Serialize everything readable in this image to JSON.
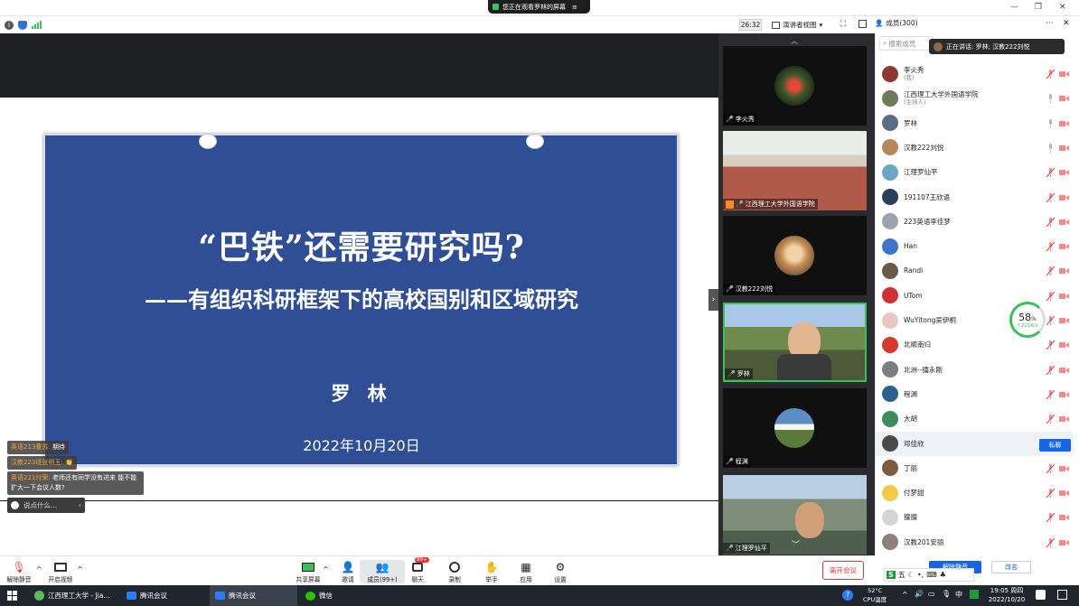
{
  "sharing_banner": {
    "text": "您正在观看罗林的屏幕"
  },
  "meeting_bar": {
    "timer": "26:32",
    "view_label": "演讲者视图",
    "members_label": "成员(300)"
  },
  "slide": {
    "title": "“巴铁”还需要研究吗?",
    "subtitle": "——有组织科研框架下的高校国别和区域研究",
    "author": "罗 林",
    "date": "2022年10月20日"
  },
  "chat": {
    "messages": [
      {
        "sender": "英语213曹苏:",
        "text": "期待"
      },
      {
        "sender": "汉教223班张明玉:",
        "text": "👏"
      },
      {
        "sender": "英语221付荣:",
        "text": "老师还有同学没有进来 能不能扩大一下会议人数?"
      }
    ],
    "input_placeholder": "说点什么..."
  },
  "video_thumbs": [
    {
      "name": "李火秀",
      "color": "#2f3a22"
    },
    {
      "name": "江西理工大学外国语学院",
      "color": "#a8b4b8"
    },
    {
      "name": "汉教222刘悦",
      "color": "#c89a6a"
    },
    {
      "name": "罗林",
      "color": "#6f8a4a"
    },
    {
      "name": "程渊",
      "color": "#4a6b8e"
    },
    {
      "name": "江理罗仙平",
      "color": "#6a7a6e"
    }
  ],
  "panel": {
    "search_placeholder": "搜索成员",
    "speaking": "正在讲话: 罗林; 汉教222刘悦",
    "members": [
      {
        "name": "李火秀",
        "sub": "(我)",
        "muted": true,
        "color": "#8c3a2f"
      },
      {
        "name": "江西理工大学外国语学院",
        "sub": "(主持人)",
        "muted": false,
        "color": "#6e7a5c"
      },
      {
        "name": "罗林",
        "sub": "",
        "muted": false,
        "color": "#5b6e85"
      },
      {
        "name": "汉教222刘悦",
        "sub": "",
        "muted": false,
        "color": "#b7875d"
      },
      {
        "name": "江理罗仙平",
        "sub": "",
        "muted": true,
        "color": "#6ba6c4"
      },
      {
        "name": "191107王欣语",
        "sub": "",
        "muted": true,
        "color": "#2b3f5a"
      },
      {
        "name": "223英语李佳梦",
        "sub": "",
        "muted": true,
        "color": "#9aa3b0"
      },
      {
        "name": "Han",
        "sub": "",
        "muted": true,
        "color": "#3b76c9"
      },
      {
        "name": "Randi",
        "sub": "",
        "muted": true,
        "color": "#6b5a46"
      },
      {
        "name": "UTom",
        "sub": "",
        "muted": true,
        "color": "#d03030"
      },
      {
        "name": "WuYitong吴伊桐",
        "sub": "",
        "muted": true,
        "color": "#e8c8c0"
      },
      {
        "name": "北顺南归",
        "sub": "",
        "muted": true,
        "color": "#d33a2a"
      },
      {
        "name": "北洲--擂永刚",
        "sub": "",
        "muted": true,
        "color": "#7a7e80"
      },
      {
        "name": "程渊",
        "sub": "",
        "muted": true,
        "color": "#2d5f8f"
      },
      {
        "name": "大胡",
        "sub": "",
        "muted": true,
        "color": "#3e8c5a"
      },
      {
        "name": "邓佳欣",
        "sub": "",
        "muted": true,
        "color": "#4a4a4a"
      },
      {
        "name": "丁丽",
        "sub": "",
        "muted": true,
        "color": "#805a40"
      },
      {
        "name": "付梦甜",
        "sub": "",
        "muted": true,
        "color": "#f2c94c"
      },
      {
        "name": "擅擅",
        "sub": "",
        "muted": true,
        "color": "#d4d4d4"
      },
      {
        "name": "汉教201安丽",
        "sub": "",
        "muted": true,
        "color": "#8f7f7f"
      }
    ],
    "private_chat": "私聊",
    "mute_all": "解除静音",
    "rename": "改名"
  },
  "perf_gauge": {
    "percent": "58",
    "unit": "%",
    "speed": "↑221K/s"
  },
  "bottom_toolbar": {
    "unmute": "解除静音",
    "video": "开启视频",
    "share": "共享屏幕",
    "invite": "邀请",
    "members": "成员(99+)",
    "chat": "聊天",
    "chat_badge": "99+",
    "record": "录制",
    "raise_hand": "举手",
    "apps": "应用",
    "settings": "设置",
    "leave": "离开会议"
  },
  "taskbar": {
    "apps": [
      "江西理工大学 - Jia...",
      "腾讯会议",
      "腾讯会议",
      "微信"
    ],
    "temp": "52°C",
    "cpu": "CPU温度",
    "ime": "中",
    "time": "19:05 周四",
    "date": "2022/10/20",
    "ime_toolbar": "五"
  }
}
